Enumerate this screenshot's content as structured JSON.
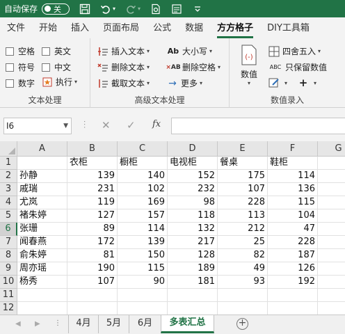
{
  "titlebar": {
    "autosave_label": "自动保存",
    "toggle_label": "关"
  },
  "menu": {
    "tabs": [
      "文件",
      "开始",
      "插入",
      "页面布局",
      "公式",
      "数据",
      "方方格子",
      "DIY工具箱"
    ],
    "active_index": 6
  },
  "ribbon": {
    "text_group": {
      "label": "文本处理",
      "checkboxes": [
        "空格",
        "英文",
        "符号",
        "中文",
        "数字"
      ],
      "execute_label": "执行"
    },
    "adv_group": {
      "label": "高级文本处理",
      "insert_text": "插入文本",
      "delete_text": "删除文本",
      "extract_text": "截取文本",
      "case_label": "大小写",
      "delete_space": "删除空格",
      "more_label": "更多"
    },
    "data_group": {
      "label": "数值录入",
      "value_label": "数值",
      "round_label": "四舍五入",
      "keep_value_label": "只保留数值"
    }
  },
  "formula_bar": {
    "name_box": "I6",
    "fx_label": "fx",
    "formula": ""
  },
  "grid": {
    "columns": [
      "A",
      "B",
      "C",
      "D",
      "E",
      "F",
      "G"
    ],
    "rows": [
      "1",
      "2",
      "3",
      "4",
      "5",
      "6",
      "7",
      "8",
      "9",
      "10",
      "11",
      "12"
    ],
    "selected_row": "6",
    "headers": [
      "",
      "衣柜",
      "橱柜",
      "电视柜",
      "餐桌",
      "鞋柜"
    ],
    "data": [
      [
        "孙静",
        "139",
        "140",
        "152",
        "175",
        "114"
      ],
      [
        "戚瑞",
        "231",
        "102",
        "232",
        "107",
        "136"
      ],
      [
        "尤岚",
        "119",
        "169",
        "98",
        "228",
        "115"
      ],
      [
        "褚朱婷",
        "127",
        "157",
        "118",
        "113",
        "104"
      ],
      [
        "张珊",
        "89",
        "114",
        "132",
        "212",
        "47"
      ],
      [
        "闻春燕",
        "172",
        "139",
        "217",
        "25",
        "228"
      ],
      [
        "俞朱婷",
        "81",
        "150",
        "128",
        "82",
        "187"
      ],
      [
        "周亦瑶",
        "190",
        "115",
        "189",
        "49",
        "126"
      ],
      [
        "杨秀",
        "107",
        "90",
        "181",
        "93",
        "192"
      ]
    ]
  },
  "sheets": {
    "tabs": [
      "4月",
      "5月",
      "6月",
      "多表汇总"
    ],
    "active_index": 3
  },
  "colors": {
    "accent": "#217346"
  }
}
